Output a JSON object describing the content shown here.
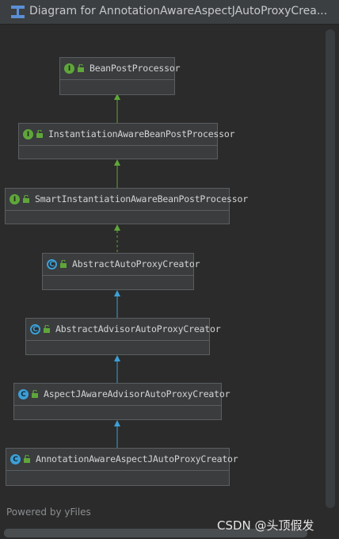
{
  "window": {
    "title": "Diagram for AnnotationAwareAspectJAutoProxyCrea..."
  },
  "diagram": {
    "nodes": [
      {
        "name": "BeanPostProcessor",
        "kind": "interface",
        "badge": "I"
      },
      {
        "name": "InstantiationAwareBeanPostProcessor",
        "kind": "interface",
        "badge": "I"
      },
      {
        "name": "SmartInstantiationAwareBeanPostProcessor",
        "kind": "interface",
        "badge": "I"
      },
      {
        "name": "AbstractAutoProxyCreator",
        "kind": "abstract-class",
        "badge": "C"
      },
      {
        "name": "AbstractAdvisorAutoProxyCreator",
        "kind": "abstract-class",
        "badge": "C"
      },
      {
        "name": "AspectJAwareAdvisorAutoProxyCreator",
        "kind": "class",
        "badge": "C"
      },
      {
        "name": "AnnotationAwareAspectJAutoProxyCreator",
        "kind": "class",
        "badge": "C"
      }
    ],
    "edge_colors": {
      "interface_extends": "#5fa63a",
      "class_extends": "#3d9fd6"
    }
  },
  "footer": {
    "powered_by": "Powered by yFiles"
  },
  "watermark": {
    "text": "CSDN @头顶假发"
  }
}
